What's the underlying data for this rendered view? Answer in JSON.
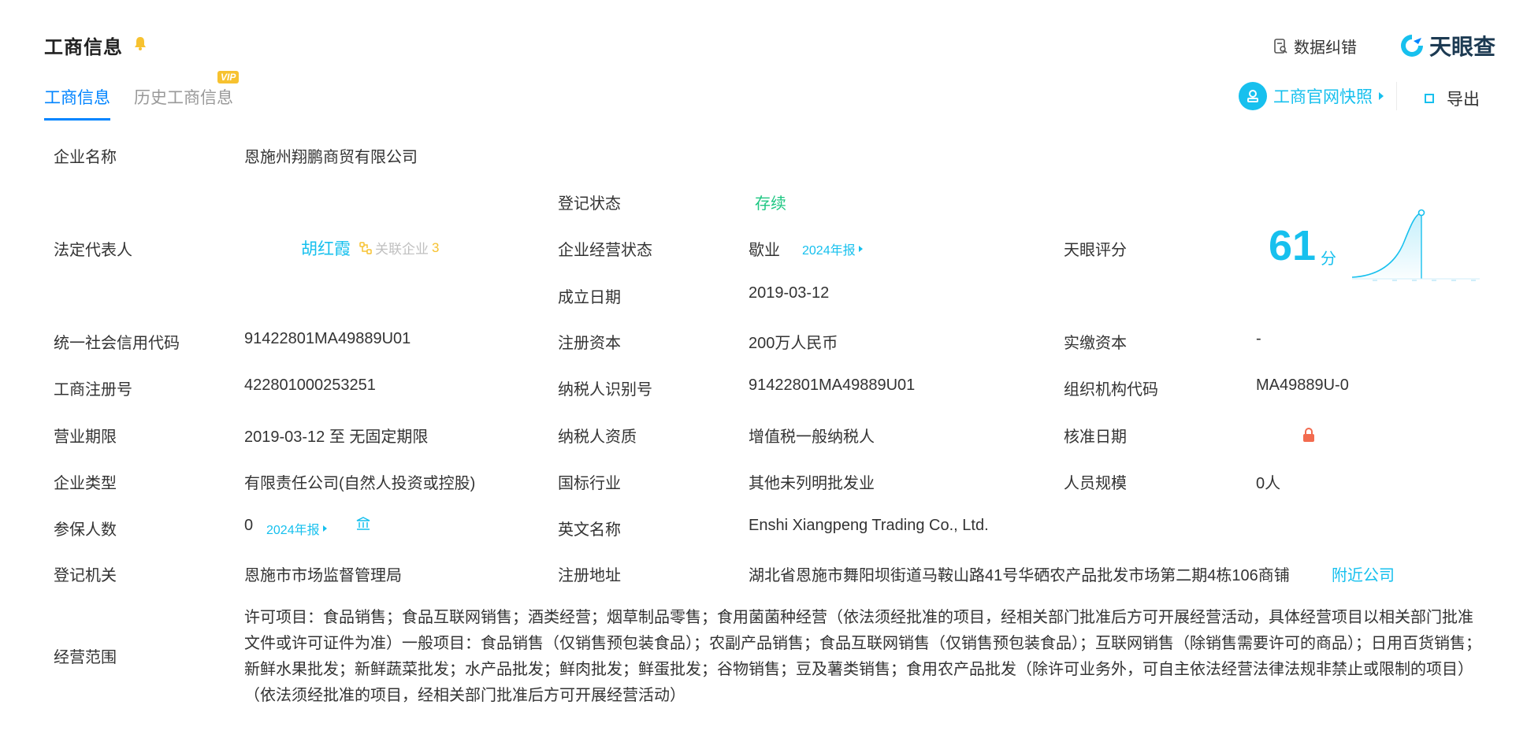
{
  "header": {
    "title": "工商信息",
    "report_link": "数据纠错",
    "logo_text": "天眼查"
  },
  "tabs": [
    {
      "label": "工商信息"
    },
    {
      "label": "历史工商信息"
    }
  ],
  "vip_badge": "VIP",
  "actions": {
    "snapshot": "工商官网快照",
    "export": "导出"
  },
  "labels": {
    "company_name": "企业名称",
    "reg_status": "登记状态",
    "legal_rep": "法定代表人",
    "op_status": "企业经营状态",
    "rating": "天眼评分",
    "founded": "成立日期",
    "credit_code": "统一社会信用代码",
    "reg_capital": "注册资本",
    "paid_capital": "实缴资本",
    "reg_number": "工商注册号",
    "taxpayer_id": "纳税人识别号",
    "org_code": "组织机构代码",
    "term": "营业期限",
    "taxpayer_type": "纳税人资质",
    "approval_date": "核准日期",
    "company_type": "企业类型",
    "industry": "国标行业",
    "staff_size": "人员规模",
    "insured": "参保人数",
    "english_name": "英文名称",
    "authority": "登记机关",
    "address": "注册地址",
    "scope": "经营范围"
  },
  "values": {
    "company_name": "恩施州翔鹏商贸有限公司",
    "reg_status": "存续",
    "legal_rep_name": "胡红霞",
    "assoc_label": "关联企业",
    "assoc_count": "3",
    "op_status": "歇业",
    "report_link": "2024年报",
    "rating_score": "61",
    "rating_unit": "分",
    "founded": "2019-03-12",
    "credit_code": "91422801MA49889U01",
    "reg_capital": "200万人民币",
    "paid_capital": "-",
    "reg_number": "422801000253251",
    "taxpayer_id": "91422801MA49889U01",
    "org_code": "MA49889U-0",
    "term": "2019-03-12 至 无固定期限",
    "taxpayer_type": "增值税一般纳税人",
    "company_type": "有限责任公司(自然人投资或控股)",
    "industry": "其他未列明批发业",
    "staff_size": "0人",
    "insured": "0",
    "insured_report": "2024年报",
    "english_name": "Enshi Xiangpeng Trading Co., Ltd.",
    "authority": "恩施市市场监督管理局",
    "address": "湖北省恩施市舞阳坝街道马鞍山路41号华硒农产品批发市场第二期4栋106商铺",
    "nearby_link": "附近公司",
    "scope": "许可项目：食品销售；食品互联网销售；酒类经营；烟草制品零售；食用菌菌种经营（依法须经批准的项目，经相关部门批准后方可开展经营活动，具体经营项目以相关部门批准文件或许可证件为准）一般项目：食品销售（仅销售预包装食品）；农副产品销售；食品互联网销售（仅销售预包装食品）；互联网销售（除销售需要许可的商品）；日用百货销售；新鲜水果批发；新鲜蔬菜批发；水产品批发；鲜肉批发；鲜蛋批发；谷物销售；豆及薯类销售；食用农产品批发（除许可业务外，可自主依法经营法律法规非禁止或限制的项目）（依法须经批准的项目，经相关部门批准后方可开展经营活动）"
  },
  "colors": {
    "accent": "#0084ff",
    "cyan": "#17c0ee",
    "green": "#1fc783",
    "vip": "#f7c230",
    "lock": "#f26b4f"
  },
  "icons": [
    "bell-icon",
    "report-icon",
    "tianyancha-logo-icon",
    "snapshot-icon",
    "export-icon",
    "related-company-icon",
    "social-security-icon",
    "lock-icon"
  ]
}
